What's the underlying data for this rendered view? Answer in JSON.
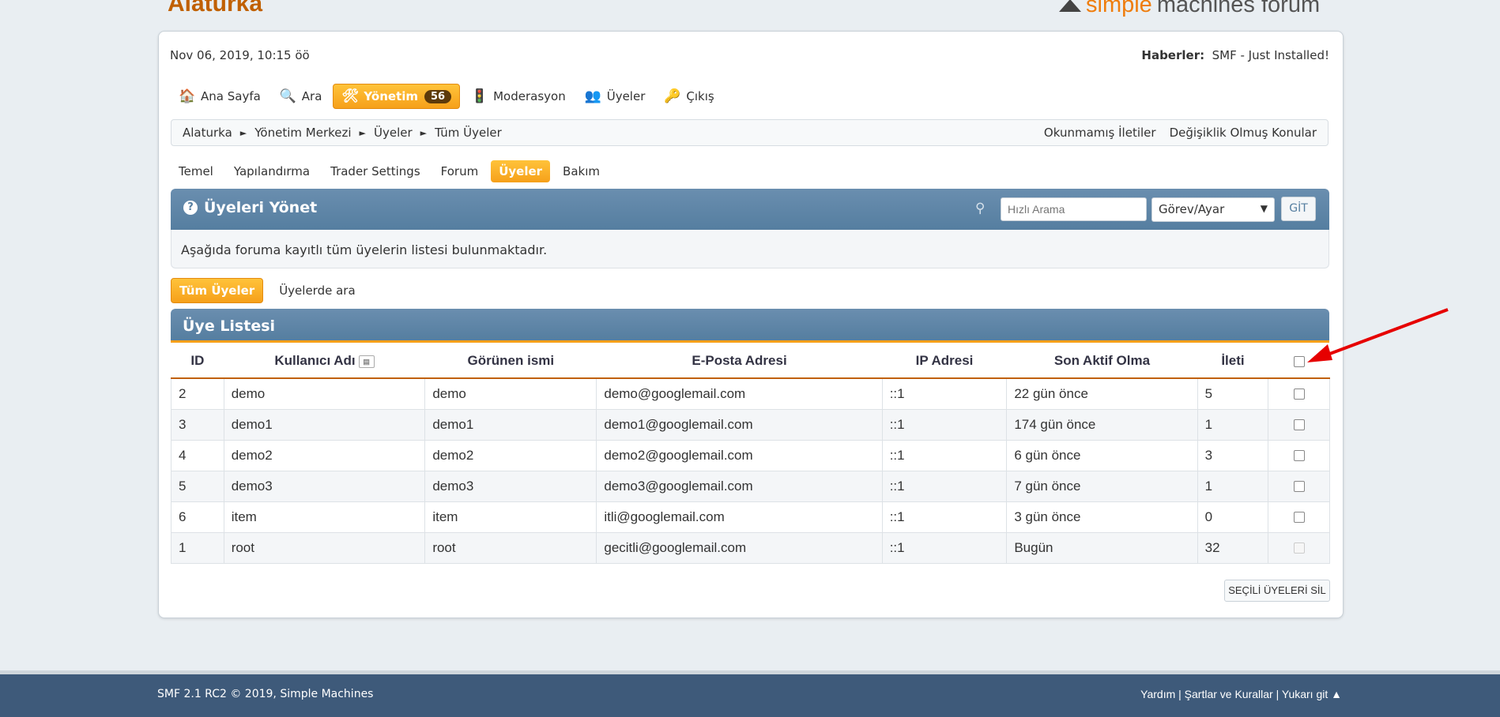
{
  "site": {
    "title": "Alaturka",
    "logo_simple": "simple",
    "logo_machines": "machines forum"
  },
  "upper": {
    "date": "Nov 06, 2019, 10:15 öö",
    "news_label": "Haberler:",
    "news_text": "SMF - Just Installed!"
  },
  "menu": {
    "home": "Ana Sayfa",
    "search": "Ara",
    "admin": "Yönetim",
    "admin_count": "56",
    "moderation": "Moderasyon",
    "members": "Üyeler",
    "logout": "Çıkış"
  },
  "breadcrumb": {
    "items": [
      "Alaturka",
      "Yönetim Merkezi",
      "Üyeler",
      "Tüm Üyeler"
    ],
    "separator": "►"
  },
  "nav_links": {
    "unread": "Okunmamış İletiler",
    "updated": "Değişiklik Olmuş Konular"
  },
  "subtabs": [
    "Temel",
    "Yapılandırma",
    "Trader Settings",
    "Forum",
    "Üyeler",
    "Bakım"
  ],
  "admin_header": {
    "title": "Üyeleri Yönet",
    "search_placeholder": "Hızlı Arama",
    "select_value": "Görev/Ayar",
    "go": "GİT"
  },
  "description": "Aşağıda foruma kayıtlı tüm üyelerin listesi bulunmaktadır.",
  "list_tabs": {
    "all": "Tüm Üyeler",
    "search": "Üyelerde ara"
  },
  "list": {
    "title": "Üye Listesi",
    "headers": [
      "ID",
      "Kullanıcı Adı",
      "Görünen ismi",
      "E-Posta Adresi",
      "IP Adresi",
      "Son Aktif Olma",
      "İleti"
    ],
    "rows": [
      {
        "id": "2",
        "user": "demo",
        "display": "demo",
        "email": "demo@googlemail.com",
        "ip": "::1",
        "last": "22 gün önce",
        "posts": "5"
      },
      {
        "id": "3",
        "user": "demo1",
        "display": "demo1",
        "email": "demo1@googlemail.com",
        "ip": "::1",
        "last": "174 gün önce",
        "posts": "1"
      },
      {
        "id": "4",
        "user": "demo2",
        "display": "demo2",
        "email": "demo2@googlemail.com",
        "ip": "::1",
        "last": "6 gün önce",
        "posts": "3"
      },
      {
        "id": "5",
        "user": "demo3",
        "display": "demo3",
        "email": "demo3@googlemail.com",
        "ip": "::1",
        "last": "7 gün önce",
        "posts": "1"
      },
      {
        "id": "6",
        "user": "item",
        "display": "item",
        "email": "itli@googlemail.com",
        "ip": "::1",
        "last": "3 gün önce",
        "posts": "0"
      },
      {
        "id": "1",
        "user": "root",
        "display": "root",
        "email": "gecitli@googlemail.com",
        "ip": "::1",
        "last": "Bugün",
        "posts": "32"
      }
    ],
    "delete_button": "SEÇİLİ ÜYELERİ SİL"
  },
  "footer": {
    "copyright": "SMF 2.1 RC2 © 2019, Simple Machines",
    "links": "Yardım | Şartlar ve Kurallar | Yukarı git ▲"
  },
  "colors": {
    "accent": "#f6a01a",
    "header_blue": "#557ea0",
    "footer": "#3e5a7a",
    "link": "#2a37c6",
    "admin_red": "#e00000"
  }
}
